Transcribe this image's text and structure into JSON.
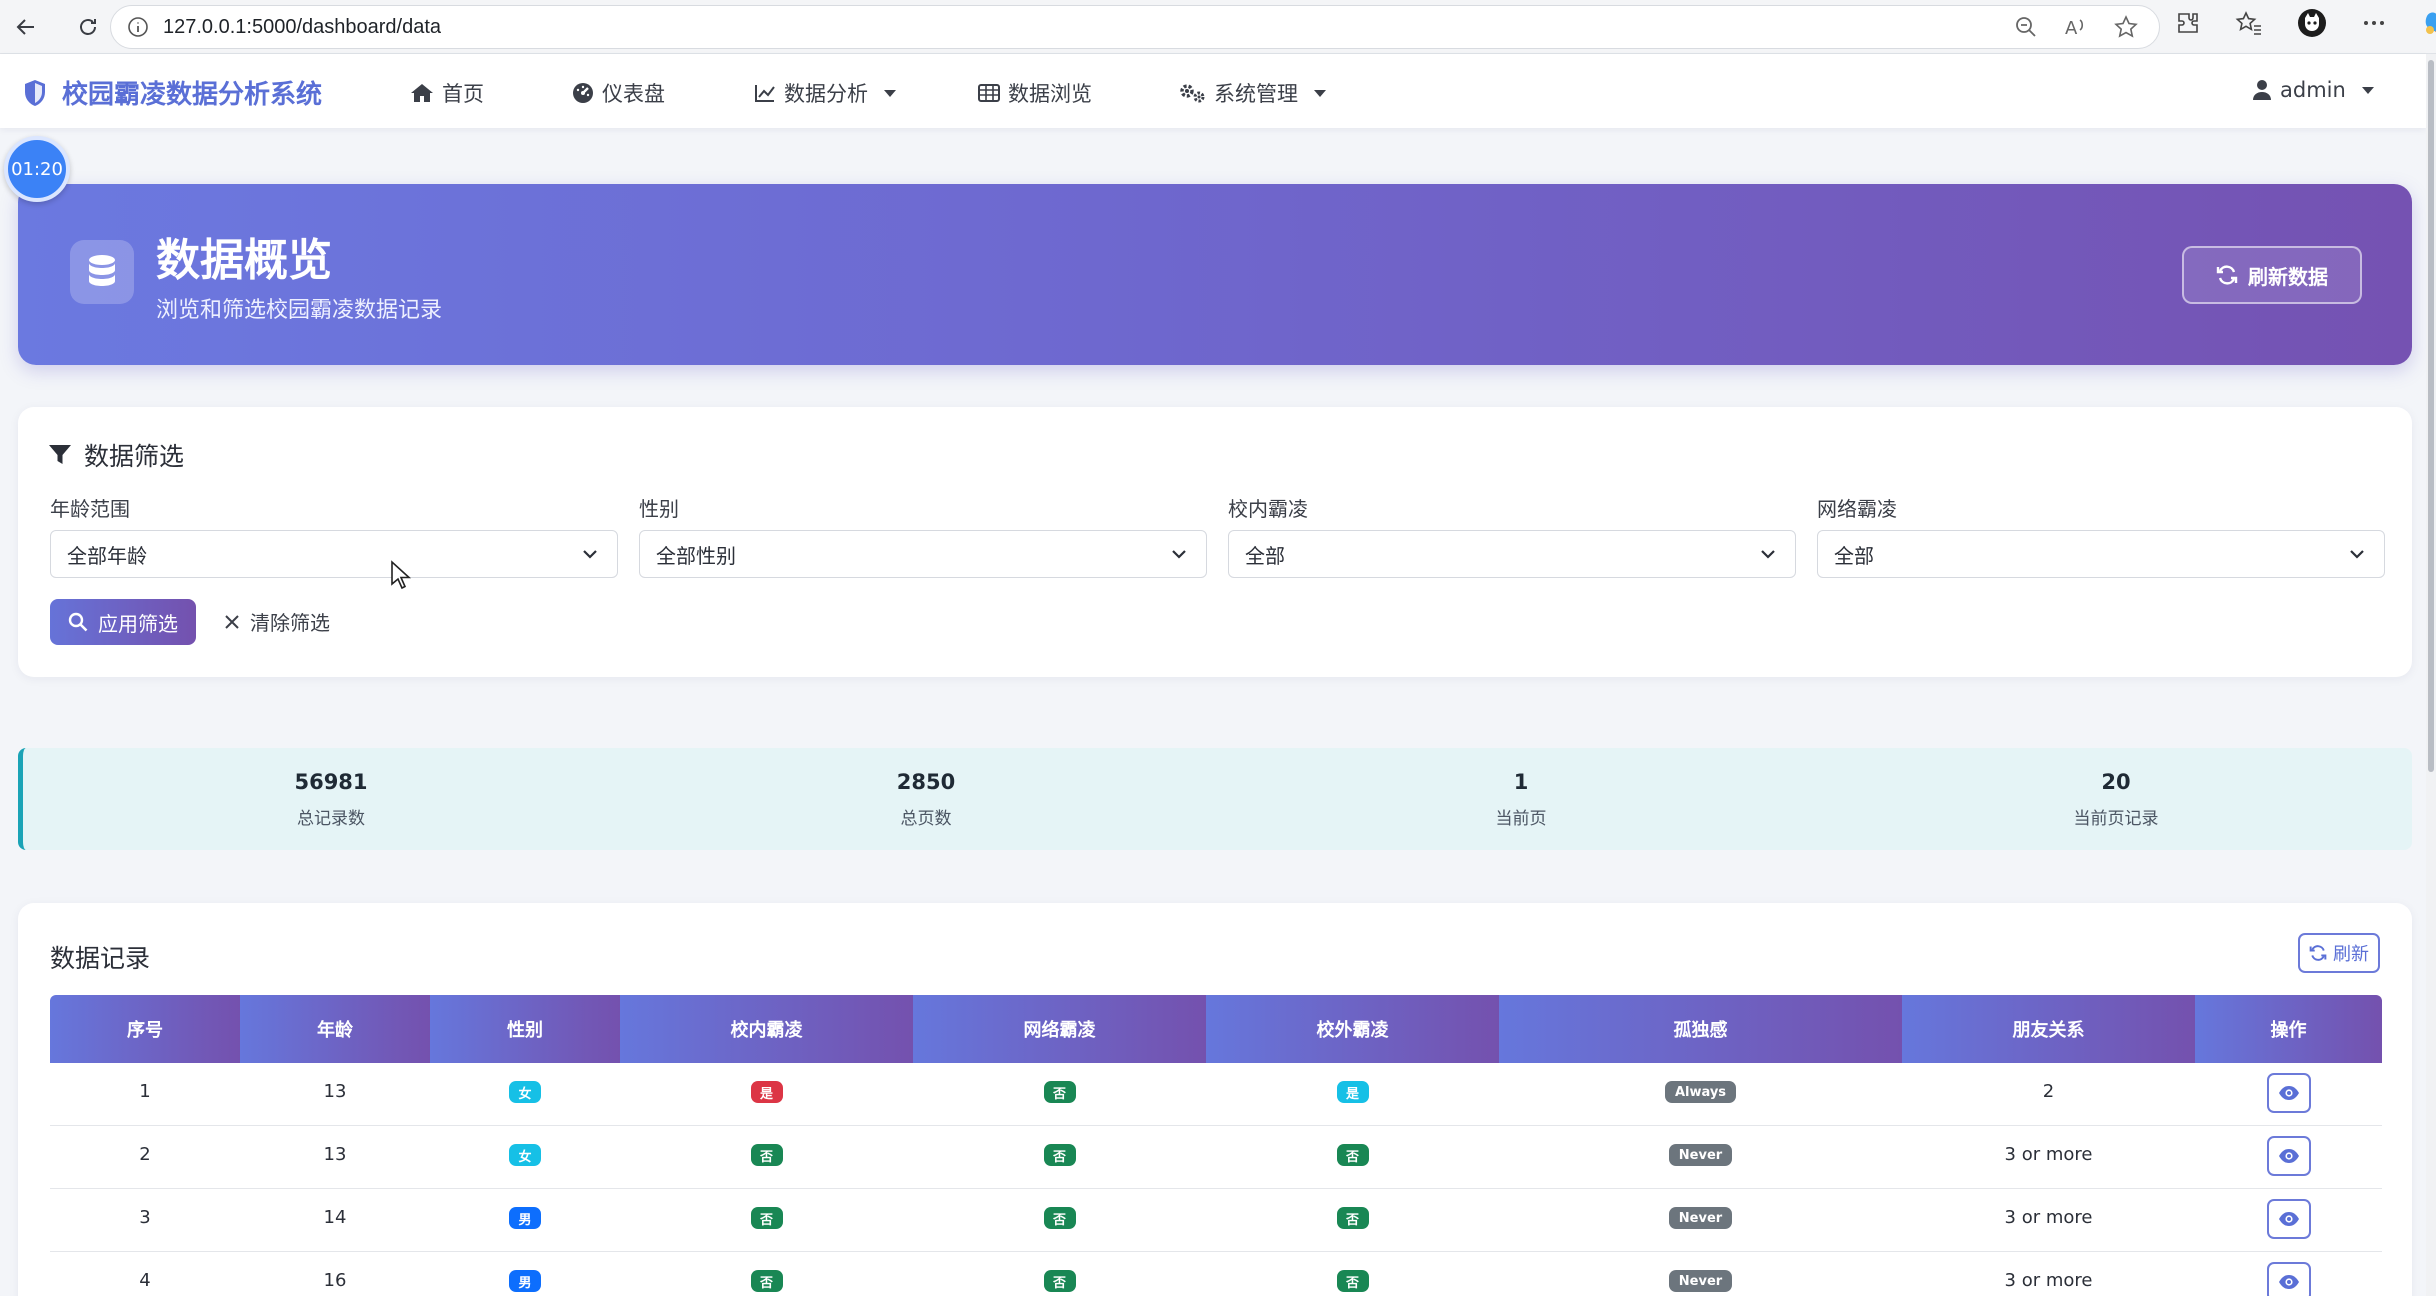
{
  "browser": {
    "url": "127.0.0.1:5000/dashboard/data"
  },
  "nav": {
    "brand": "校园霸凌数据分析系统",
    "items": [
      {
        "label": "首页",
        "icon": "home-icon"
      },
      {
        "label": "仪表盘",
        "icon": "dashboard-icon"
      },
      {
        "label": "数据分析",
        "icon": "chart-line-icon",
        "dropdown": true
      },
      {
        "label": "数据浏览",
        "icon": "table-icon"
      },
      {
        "label": "系统管理",
        "icon": "gears-icon",
        "dropdown": true
      }
    ],
    "user": "admin"
  },
  "timer": "01:20",
  "hero": {
    "title": "数据概览",
    "subtitle": "浏览和筛选校园霸凌数据记录",
    "refresh_label": "刷新数据"
  },
  "filters": {
    "title": "数据筛选",
    "fields": [
      {
        "label": "年龄范围",
        "value": "全部年龄"
      },
      {
        "label": "性别",
        "value": "全部性别"
      },
      {
        "label": "校内霸凌",
        "value": "全部"
      },
      {
        "label": "网络霸凌",
        "value": "全部"
      }
    ],
    "apply_label": "应用筛选",
    "clear_label": "清除筛选"
  },
  "stats": [
    {
      "value": "56981",
      "label": "总记录数"
    },
    {
      "value": "2850",
      "label": "总页数"
    },
    {
      "value": "1",
      "label": "当前页"
    },
    {
      "value": "20",
      "label": "当前页记录"
    }
  ],
  "records": {
    "title": "数据记录",
    "refresh_label": "刷新",
    "columns": [
      "序号",
      "年龄",
      "性别",
      "校内霸凌",
      "网络霸凌",
      "校外霸凌",
      "孤独感",
      "朋友关系",
      "操作"
    ],
    "rows": [
      {
        "id": "1",
        "age": "13",
        "gender": "女",
        "school": "是",
        "cyber": "否",
        "outside": "是",
        "lonely": "Always",
        "friends": "2"
      },
      {
        "id": "2",
        "age": "13",
        "gender": "女",
        "school": "否",
        "cyber": "否",
        "outside": "否",
        "lonely": "Never",
        "friends": "3 or more"
      },
      {
        "id": "3",
        "age": "14",
        "gender": "男",
        "school": "否",
        "cyber": "否",
        "outside": "否",
        "lonely": "Never",
        "friends": "3 or more"
      },
      {
        "id": "4",
        "age": "16",
        "gender": "男",
        "school": "否",
        "cyber": "否",
        "outside": "否",
        "lonely": "Never",
        "friends": "3 or more"
      }
    ]
  },
  "colors": {
    "brand": "#5a6fd6",
    "gradient_start": "#6b79e0",
    "gradient_end": "#7552b2",
    "badge_female": "#16c0e6",
    "badge_male": "#0d6efd",
    "badge_yes": "#dc3545",
    "badge_no": "#198754",
    "badge_outside_yes": "#16c0e6",
    "badge_lonely": "#6c757d"
  }
}
